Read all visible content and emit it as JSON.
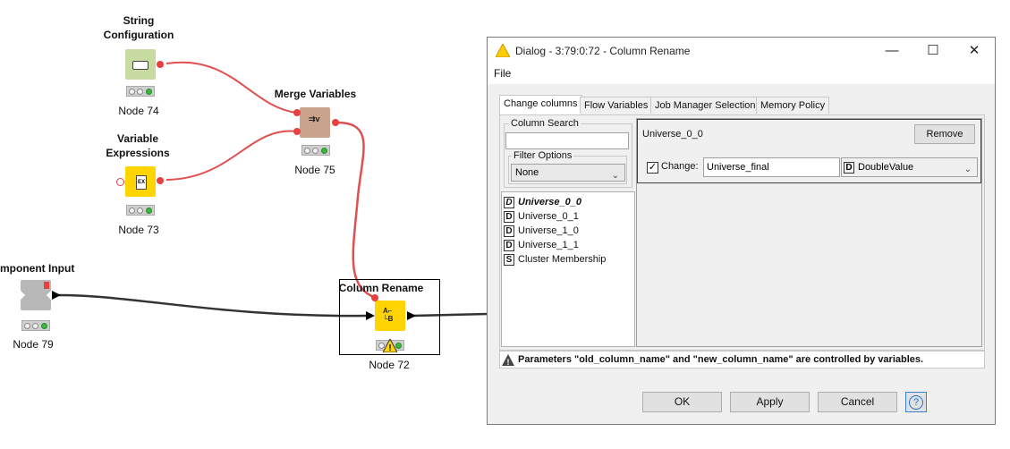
{
  "workflow": {
    "nodes": [
      {
        "id": "string_config",
        "title": "String Configuration",
        "title_lines": [
          "String",
          "Configuration"
        ],
        "label": "Node 74",
        "icon": "string-config-icon",
        "color": "#c8dba0"
      },
      {
        "id": "variable_expressions",
        "title": "Variable Expressions",
        "title_lines": [
          "Variable",
          "Expressions"
        ],
        "label": "Node 73",
        "icon": "expression-icon",
        "color": "#ffd400"
      },
      {
        "id": "merge_variables",
        "title": "Merge Variables",
        "title_lines": [
          "Merge Variables"
        ],
        "label": "Node 75",
        "icon": "merge-variables-icon",
        "color": "#c9a38c"
      },
      {
        "id": "component_input",
        "title": "mponent Input",
        "title_lines": [
          "mponent Input"
        ],
        "label": "Node 79",
        "icon": "component-input-icon",
        "color": "#b8b8b8"
      },
      {
        "id": "column_rename",
        "title": "Column Rename",
        "title_lines": [
          "Column Rename"
        ],
        "label": "Node 72",
        "icon": "column-rename-icon",
        "color": "#ffd400",
        "selected": true,
        "status": "warning"
      }
    ],
    "colors": {
      "variable_connection": "#e05050",
      "data_connection": "#333333"
    }
  },
  "dialog": {
    "title": "Dialog - 3:79:0:72 - Column Rename",
    "window_icon": "warning-triangle-icon",
    "menu": {
      "file": "File"
    },
    "tabs": [
      "Change columns",
      "Flow Variables",
      "Job Manager Selection",
      "Memory Policy"
    ],
    "active_tab": 0,
    "column_search": {
      "label": "Column Search",
      "value": ""
    },
    "filter_options": {
      "label": "Filter Options",
      "selected": "None"
    },
    "columns": [
      {
        "type": "D",
        "name": "Universe_0_0",
        "emphasized": true
      },
      {
        "type": "D",
        "name": "Universe_0_1"
      },
      {
        "type": "D",
        "name": "Universe_1_0"
      },
      {
        "type": "D",
        "name": "Universe_1_1"
      },
      {
        "type": "S",
        "name": "Cluster Membership"
      }
    ],
    "rename": {
      "column": "Universe_0_0",
      "remove_label": "Remove",
      "change_label": "Change:",
      "change_checked": true,
      "new_name": "Universe_final",
      "type_badge": "D",
      "type_value": "DoubleValue"
    },
    "status_message": "Parameters \"old_column_name\" and \"new_column_name\" are controlled by variables.",
    "buttons": {
      "ok": "OK",
      "apply": "Apply",
      "cancel": "Cancel",
      "help": "?"
    }
  }
}
